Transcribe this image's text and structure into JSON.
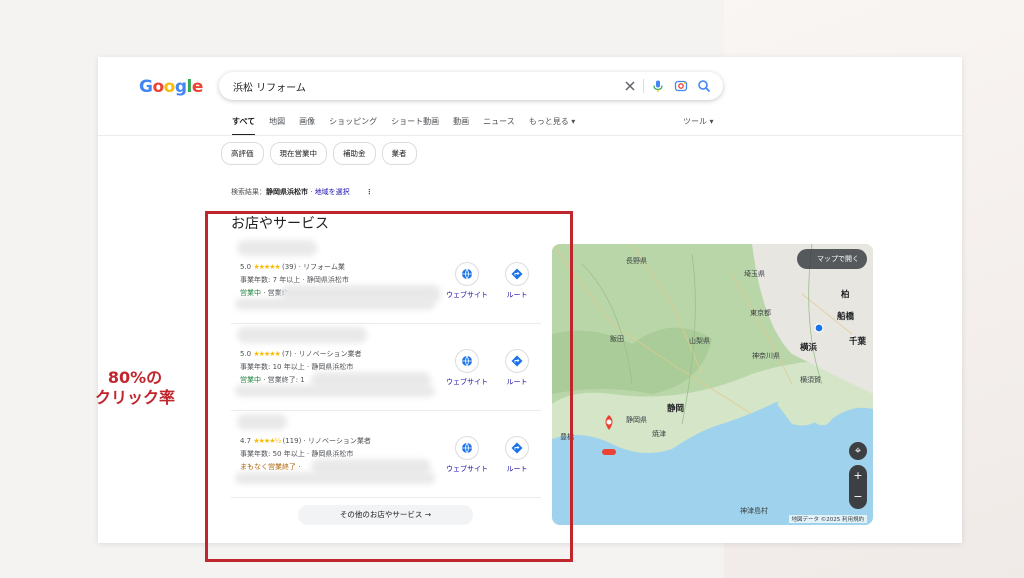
{
  "google_logo": [
    "G",
    "o",
    "o",
    "g",
    "l",
    "e"
  ],
  "search": {
    "query": "浜松 リフォーム"
  },
  "tabs": [
    {
      "label": "すべて",
      "active": true
    },
    {
      "label": "地図"
    },
    {
      "label": "画像"
    },
    {
      "label": "ショッピング"
    },
    {
      "label": "ショート動画"
    },
    {
      "label": "動画"
    },
    {
      "label": "ニュース"
    },
    {
      "label": "もっと見る ▾"
    }
  ],
  "tools_label": "ツール ▾",
  "chips": [
    "高評価",
    "現在営業中",
    "補助金",
    "業者"
  ],
  "location": {
    "prefix": "検索結果：",
    "place": "静岡県浜松市",
    "sep": " · ",
    "link": "地域を選択"
  },
  "section_title": "お店やサービス",
  "listings": [
    {
      "rating": "5.0",
      "stars": "★★★★★",
      "reviews": "(39)",
      "category": "リフォーム業",
      "meta": "事業年数: 7 年以上 · 静岡県浜松市",
      "status": "営業中",
      "status_rest": " · 営業終",
      "status_type": "open"
    },
    {
      "rating": "5.0",
      "stars": "★★★★★",
      "reviews": "(7)",
      "category": "リノベーション業者",
      "meta": "事業年数: 10 年以上 · 静岡県浜松市",
      "status": "営業中",
      "status_rest": " · 営業終了: 1",
      "status_type": "open"
    },
    {
      "rating": "4.7",
      "stars": "★★★★½",
      "reviews": "(119)",
      "category": "リノベーション業者",
      "meta": "事業年数: 50 年以上 · 静岡県浜松市",
      "status": "まもなく営業終了",
      "status_rest": " ·",
      "status_type": "closing"
    }
  ],
  "actions": {
    "website": "ウェブサイト",
    "route": "ルート"
  },
  "more_button": "その他のお店やサービス  →",
  "map": {
    "open_label": "マップで開く",
    "labels": {
      "nagano": "長野県",
      "saitama": "埼玉県",
      "tokyo": "東京都",
      "yamanashi": "山梨県",
      "kanagawa": "神奈川県",
      "iida": "飯田",
      "kashiwa": "柏",
      "funabashi": "船橋",
      "yokohama": "横浜",
      "chiba": "千葉",
      "yokosuka": "横須賀",
      "shizuoka_city": "静岡",
      "shizuoka_pref": "静岡県",
      "yaizu": "焼津",
      "toyohashi": "豊橋",
      "kozushima": "神津島村"
    },
    "footer": "地図データ ©2025   利用規約"
  },
  "annotation": {
    "line1": "80%の",
    "line2": "クリック率"
  },
  "colors": {
    "highlight": "#c0272d",
    "star": "#fbbc04",
    "open": "#188038",
    "closing": "#b06000",
    "link": "#1a0dab"
  }
}
